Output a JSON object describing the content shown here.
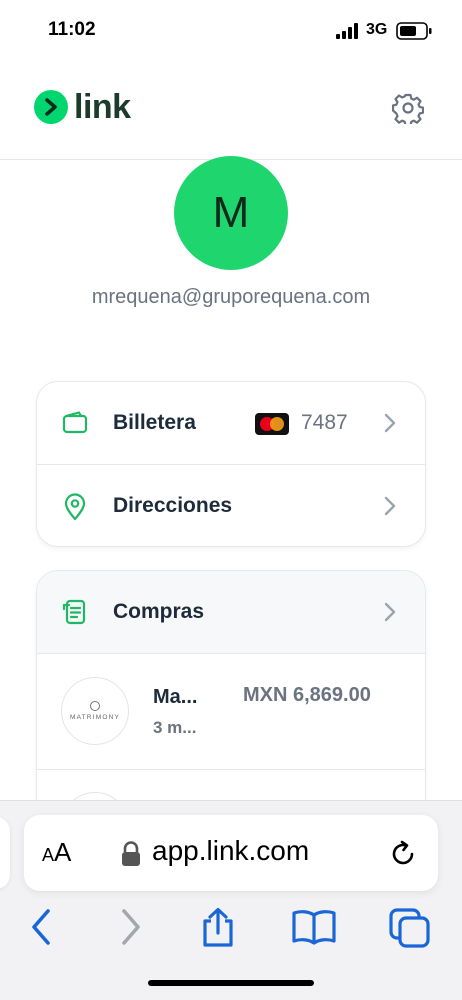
{
  "status_bar": {
    "time": "11:02",
    "network": "3G",
    "icons": [
      "signal-bars-icon",
      "battery-icon"
    ]
  },
  "header": {
    "logo_text": "link",
    "logo_icon": "chevron-right-icon",
    "settings_icon": "gear-icon"
  },
  "profile": {
    "avatar_initial": "M",
    "avatar_color": "#1fd66e",
    "email": "mrequena@gruporequena.com"
  },
  "account": {
    "wallet": {
      "label": "Billetera",
      "icon": "wallet-icon",
      "card_brand": "mastercard-icon",
      "card_last4": "7487"
    },
    "addresses": {
      "label": "Direcciones",
      "icon": "location-pin-icon"
    }
  },
  "purchases": {
    "label": "Compras",
    "icon": "receipt-icon",
    "items": [
      {
        "merchant_logo_text": "MATRIMONY",
        "name": "Ma...",
        "date": "3 m...",
        "amount": "MXN 6,869.00"
      }
    ]
  },
  "browser": {
    "text_size_label_large": "A",
    "text_size_label_small": "A",
    "url": "app.link.com",
    "icons": [
      "lock-icon",
      "reload-icon",
      "back-icon",
      "forward-icon",
      "share-icon",
      "bookmarks-icon",
      "tabs-icon"
    ]
  },
  "colors": {
    "brand_green": "#00d66f",
    "text_dark": "#1d2b3a",
    "text_muted": "#6b7280",
    "safari_blue": "#1a66d6",
    "icon_green": "#1fb864"
  }
}
